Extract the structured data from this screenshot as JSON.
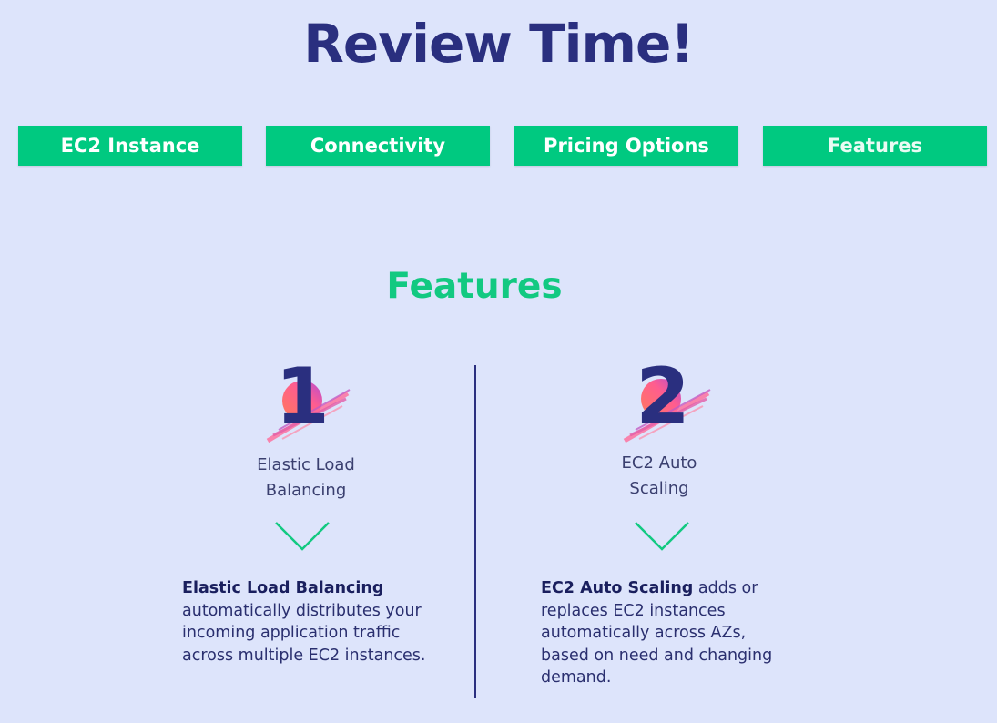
{
  "page": {
    "title": "Review Time!"
  },
  "tabs": [
    {
      "label": "EC2 Instance"
    },
    {
      "label": "Connectivity"
    },
    {
      "label": "Pricing Options"
    },
    {
      "label": "Features"
    }
  ],
  "section": {
    "title": "Features"
  },
  "features": [
    {
      "number": "1",
      "label_line1": "Elastic Load",
      "label_line2": "Balancing",
      "desc_bold": "Elastic Load Balancing",
      "desc_lines": [
        "automatically distributes your",
        "incoming application traffic",
        "across multiple EC2 instances."
      ]
    },
    {
      "number": "2",
      "label_line1": "EC2 Auto",
      "label_line2": "Scaling",
      "desc_bold": "EC2 Auto Scaling",
      "desc_rest_first": " adds or",
      "desc_lines": [
        "replaces EC2 instances",
        "automatically across AZs,",
        "based on need and changing",
        "demand."
      ]
    }
  ],
  "colors": {
    "accent": "#00c980",
    "navy": "#2a2f7f",
    "background": "#dde4fb"
  },
  "icons": {
    "chevron": "chevron-down-icon",
    "brush": "brush-stroke-decoration"
  }
}
